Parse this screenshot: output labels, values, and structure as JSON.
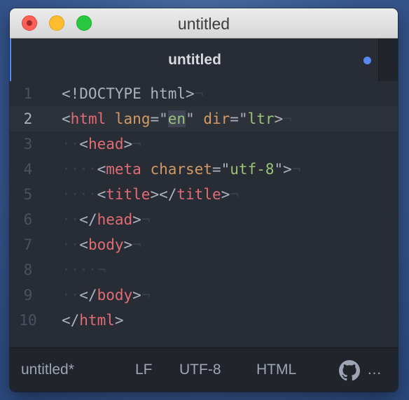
{
  "window": {
    "title": "untitled"
  },
  "tab": {
    "title": "untitled",
    "modified_indicator_color": "#568af2"
  },
  "editor": {
    "lines": [
      {
        "number": "1"
      },
      {
        "number": "2"
      },
      {
        "number": "3"
      },
      {
        "number": "4"
      },
      {
        "number": "5"
      },
      {
        "number": "6"
      },
      {
        "number": "7"
      },
      {
        "number": "8"
      },
      {
        "number": "9"
      },
      {
        "number": "10"
      }
    ],
    "tokens": {
      "doctype": "<!DOCTYPE html>",
      "html_tag": "html",
      "lang_attr": "lang",
      "lang_value": "en",
      "dir_attr": "dir",
      "dir_value": "ltr",
      "head_tag": "head",
      "meta_tag": "meta",
      "charset_attr": "charset",
      "charset_value": "utf-8",
      "title_tag": "title",
      "body_tag": "body"
    },
    "current_line": "2"
  },
  "status_bar": {
    "file": "untitled*",
    "line_ending": "LF",
    "encoding": "UTF-8",
    "grammar": "HTML",
    "more": "…",
    "github_icon": "github-icon"
  },
  "colors": {
    "tag": "#e06c75",
    "attribute": "#d19a66",
    "string": "#98c379",
    "text": "#abb2bf",
    "background": "#282c34"
  }
}
